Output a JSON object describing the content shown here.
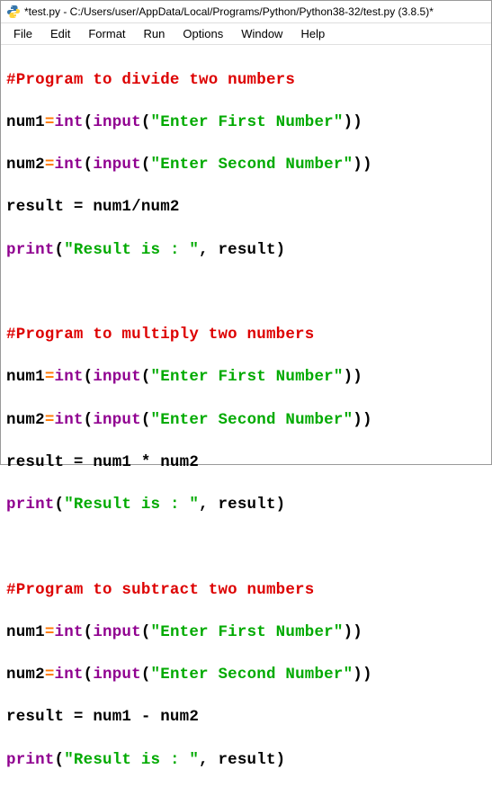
{
  "window": {
    "title": "*test.py - C:/Users/user/AppData/Local/Programs/Python/Python38-32/test.py (3.8.5)*"
  },
  "menu": {
    "file": "File",
    "edit": "Edit",
    "format": "Format",
    "run": "Run",
    "options": "Options",
    "window": "Window",
    "help": "Help"
  },
  "code": {
    "b1": {
      "comment": "#Program to divide two numbers",
      "l1_v": "num1",
      "l1_op": "=",
      "l1_int": "int",
      "l1_p1": "(",
      "l1_input": "input",
      "l1_p2": "(",
      "l1_str": "\"Enter First Number\"",
      "l1_p3": ")",
      "l1_p4": ")",
      "l2_v": "num2",
      "l2_op": "=",
      "l2_int": "int",
      "l2_p1": "(",
      "l2_input": "input",
      "l2_p2": "(",
      "l2_str": "\"Enter Second Number\"",
      "l2_p3": ")",
      "l2_p4": ")",
      "l3": "result = num1/num2",
      "l4_print": "print",
      "l4_p1": "(",
      "l4_str": "\"Result is : \"",
      "l4_rest": ", result)"
    },
    "b2": {
      "comment": "#Program to multiply two numbers",
      "l1_v": "num1",
      "l1_op": "=",
      "l1_int": "int",
      "l1_p1": "(",
      "l1_input": "input",
      "l1_p2": "(",
      "l1_str": "\"Enter First Number\"",
      "l1_p3": ")",
      "l1_p4": ")",
      "l2_v": "num2",
      "l2_op": "=",
      "l2_int": "int",
      "l2_p1": "(",
      "l2_input": "input",
      "l2_p2": "(",
      "l2_str": "\"Enter Second Number\"",
      "l2_p3": ")",
      "l2_p4": ")",
      "l3": "result = num1 * num2",
      "l4_print": "print",
      "l4_p1": "(",
      "l4_str": "\"Result is : \"",
      "l4_rest": ", result)"
    },
    "b3": {
      "comment": "#Program to subtract two numbers",
      "l1_v": "num1",
      "l1_op": "=",
      "l1_int": "int",
      "l1_p1": "(",
      "l1_input": "input",
      "l1_p2": "(",
      "l1_str": "\"Enter First Number\"",
      "l1_p3": ")",
      "l1_p4": ")",
      "l2_v": "num2",
      "l2_op": "=",
      "l2_int": "int",
      "l2_p1": "(",
      "l2_input": "input",
      "l2_p2": "(",
      "l2_str": "\"Enter Second Number\"",
      "l2_p3": ")",
      "l2_p4": ")",
      "l3": "result = num1 - num2",
      "l4_print": "print",
      "l4_p1": "(",
      "l4_str": "\"Result is : \"",
      "l4_rest": ", result)"
    }
  }
}
